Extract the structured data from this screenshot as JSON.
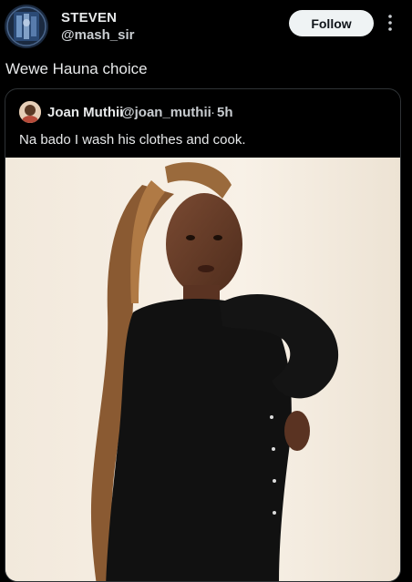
{
  "post": {
    "author": {
      "name": "STEVEN",
      "handle": "@mash_sir"
    },
    "follow_label": "Follow",
    "text": "Wewe Hauna choice",
    "more_icon": "more-vertical-icon"
  },
  "quote": {
    "author": {
      "name": "Joan Muthii",
      "handle": "@joan_muthii"
    },
    "separator": "·",
    "time": "5h",
    "text": "Na bado I wash his clothes and cook."
  },
  "colors": {
    "background": "#000000",
    "text_primary": "#e7e9ea",
    "text_secondary": "#c9cdd1",
    "follow_bg": "#eff3f4",
    "follow_text": "#0f1419",
    "card_border": "#2f3336"
  }
}
